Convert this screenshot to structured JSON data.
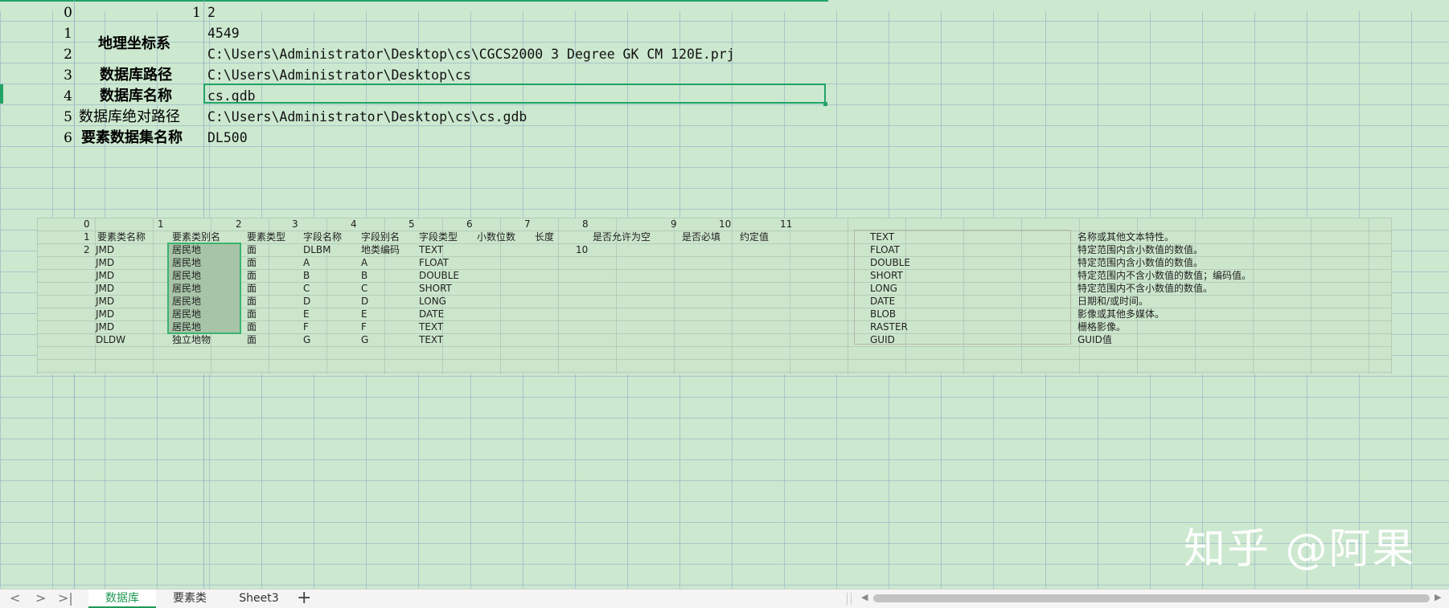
{
  "sheet": {
    "rows": [
      {
        "idx": "0",
        "label": "1",
        "value": "2"
      },
      {
        "idx": "1",
        "label": "",
        "value": "4549"
      },
      {
        "idx": "2",
        "label": "",
        "value": "C:\\Users\\Administrator\\Desktop\\cs\\CGCS2000 3 Degree GK CM 120E.prj"
      },
      {
        "idx": "3",
        "label": "数据库路径",
        "value": "C:\\Users\\Administrator\\Desktop\\cs"
      },
      {
        "idx": "4",
        "label": "数据库名称",
        "value": "cs.gdb"
      },
      {
        "idx": "5",
        "label": "数据库绝对路径",
        "value": "C:\\Users\\Administrator\\Desktop\\cs\\cs.gdb"
      },
      {
        "idx": "6",
        "label": "要素数据集名称",
        "value": "DL500"
      }
    ],
    "merged_label": "地理坐标系"
  },
  "picture": {
    "col_indices": [
      "0",
      "1",
      "2",
      "3",
      "4",
      "5",
      "6",
      "7",
      "8",
      "9",
      "10",
      "11"
    ],
    "row_indices": [
      "1",
      "2"
    ],
    "headers": [
      "要素类名称",
      "要素类别名",
      "要素类型",
      "字段名称",
      "字段别名",
      "字段类型",
      "小数位数",
      "长度",
      "是否允许为空",
      "是否必填",
      "约定值"
    ],
    "rows": [
      [
        "JMD",
        "居民地",
        "面",
        "DLBM",
        "地类编码",
        "TEXT",
        "",
        "10"
      ],
      [
        "JMD",
        "居民地",
        "面",
        "A",
        "A",
        "FLOAT"
      ],
      [
        "JMD",
        "居民地",
        "面",
        "B",
        "B",
        "DOUBLE"
      ],
      [
        "JMD",
        "居民地",
        "面",
        "C",
        "C",
        "SHORT"
      ],
      [
        "JMD",
        "居民地",
        "面",
        "D",
        "D",
        "LONG"
      ],
      [
        "JMD",
        "居民地",
        "面",
        "E",
        "E",
        "DATE"
      ],
      [
        "JMD",
        "居民地",
        "面",
        "F",
        "F",
        "TEXT"
      ],
      [
        "DLDW",
        "独立地物",
        "面",
        "G",
        "G",
        "TEXT"
      ]
    ],
    "types": [
      {
        "name": "TEXT",
        "desc": "名称或其他文本特性。"
      },
      {
        "name": "FLOAT",
        "desc": "特定范围内含小数值的数值。"
      },
      {
        "name": "DOUBLE",
        "desc": "特定范围内含小数值的数值。"
      },
      {
        "name": "SHORT",
        "desc": "特定范围内不含小数值的数值；编码值。"
      },
      {
        "name": "LONG",
        "desc": "特定范围内不含小数值的数值。"
      },
      {
        "name": "DATE",
        "desc": "日期和/或时间。"
      },
      {
        "name": "BLOB",
        "desc": "影像或其他多媒体。"
      },
      {
        "name": "RASTER",
        "desc": "栅格影像。"
      },
      {
        "name": "GUID",
        "desc": "GUID值"
      }
    ]
  },
  "watermark": "知乎 @阿果",
  "tabs": [
    {
      "label": "数据库",
      "active": true
    },
    {
      "label": "要素类",
      "active": false
    },
    {
      "label": "Sheet3",
      "active": false
    }
  ],
  "nav": {
    "prev": "<",
    "next": ">",
    "last": ">|",
    "add": "+"
  },
  "colors": {
    "accent": "#21a366",
    "sheet_bg": "#cce8cf"
  }
}
